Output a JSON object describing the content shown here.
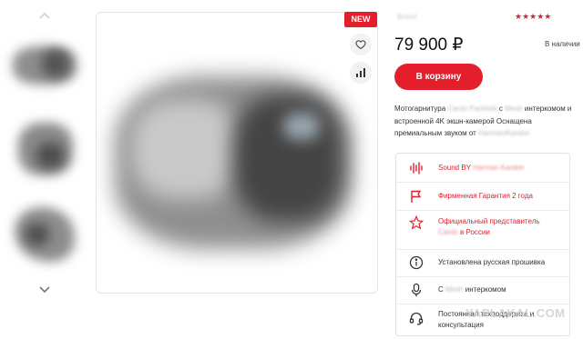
{
  "badge": {
    "new": "NEW"
  },
  "product": {
    "brand": "Brand",
    "rating_stars": "★★★★★",
    "price": "79 900 ₽",
    "availability": "В наличии",
    "cart_button": "В корзину",
    "description": {
      "p1": "Мотогарнитура ",
      "blur1": "Cardo Packtalk",
      "p2": " с ",
      "blur2": "Mesh",
      "p3": " интеркомом и встроенной 4K экшн-камерой Оснащена премиальным звуком от ",
      "blur3": "Harman/Kardon"
    }
  },
  "features": [
    {
      "icon": "sound-wave-icon",
      "label": "Sound BY ",
      "blur": "Harman Kardon",
      "label2": "",
      "color": "red"
    },
    {
      "icon": "flag-icon",
      "label": "Фирменная Гарантия 2 года",
      "blur": "",
      "label2": "",
      "color": "red"
    },
    {
      "icon": "star-icon",
      "label": "Официальный представитель ",
      "blur": "Cardo",
      "label2": " в России",
      "color": "red"
    },
    {
      "icon": "info-icon",
      "label": "Установлена русская прошивка",
      "blur": "",
      "label2": "",
      "color": "dark"
    },
    {
      "icon": "microphone-icon",
      "label": "С ",
      "blur": "Mesh",
      "label2": " интеркомом",
      "color": "dark"
    },
    {
      "icon": "headset-icon",
      "label": "Постоянная техподдержка и консультация",
      "blur": "",
      "label2": "",
      "color": "dark"
    }
  ],
  "watermark": "YAPLAKAL.COM",
  "colors": {
    "accent": "#e41e2b"
  }
}
